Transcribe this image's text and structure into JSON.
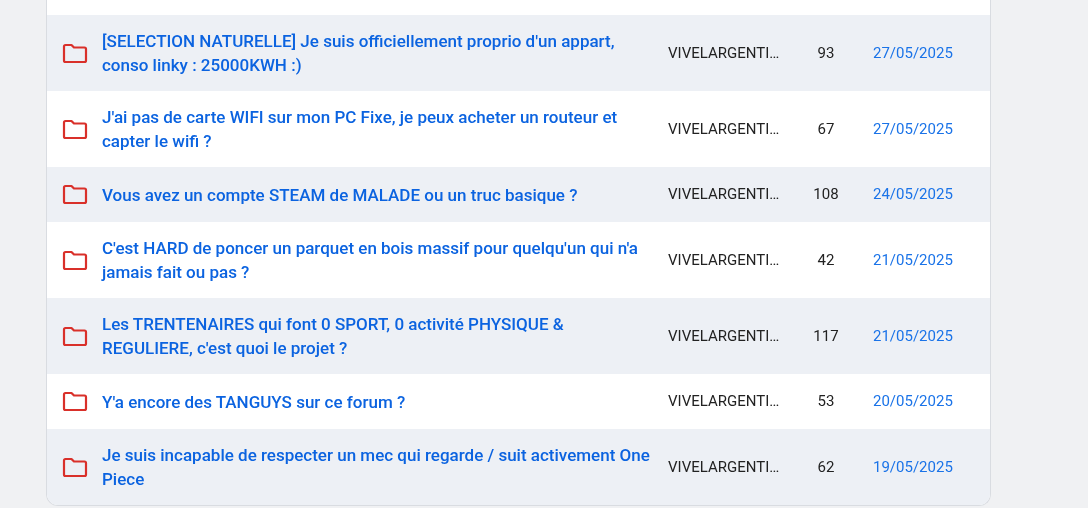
{
  "topics": [
    {
      "title": "[SELECTION NATURELLE] Je suis officiellement proprio d'un appart, conso linky : 25000KWH :)",
      "author": "VIVELARGENTI…",
      "replies": "93",
      "date": "27/05/2025"
    },
    {
      "title": "J'ai pas de carte WIFI sur mon PC Fixe, je peux acheter un routeur et capter le wifi ?",
      "author": "VIVELARGENTI…",
      "replies": "67",
      "date": "27/05/2025"
    },
    {
      "title": "Vous avez un compte STEAM de MALADE ou un truc basique ?",
      "author": "VIVELARGENTI…",
      "replies": "108",
      "date": "24/05/2025"
    },
    {
      "title": "C'est HARD de poncer un parquet en bois massif pour quelqu'un qui n'a jamais fait ou pas ?",
      "author": "VIVELARGENTI…",
      "replies": "42",
      "date": "21/05/2025"
    },
    {
      "title": "Les TRENTENAIRES qui font 0 SPORT, 0 activité PHYSIQUE & REGULIERE, c'est quoi le projet ?",
      "author": "VIVELARGENTI…",
      "replies": "117",
      "date": "21/05/2025"
    },
    {
      "title": "Y'a encore des TANGUYS sur ce forum ?",
      "author": "VIVELARGENTI…",
      "replies": "53",
      "date": "20/05/2025"
    },
    {
      "title": "Je suis incapable de respecter un mec qui regarde / suit activement One Piece",
      "author": "VIVELARGENTI…",
      "replies": "62",
      "date": "19/05/2025"
    }
  ]
}
